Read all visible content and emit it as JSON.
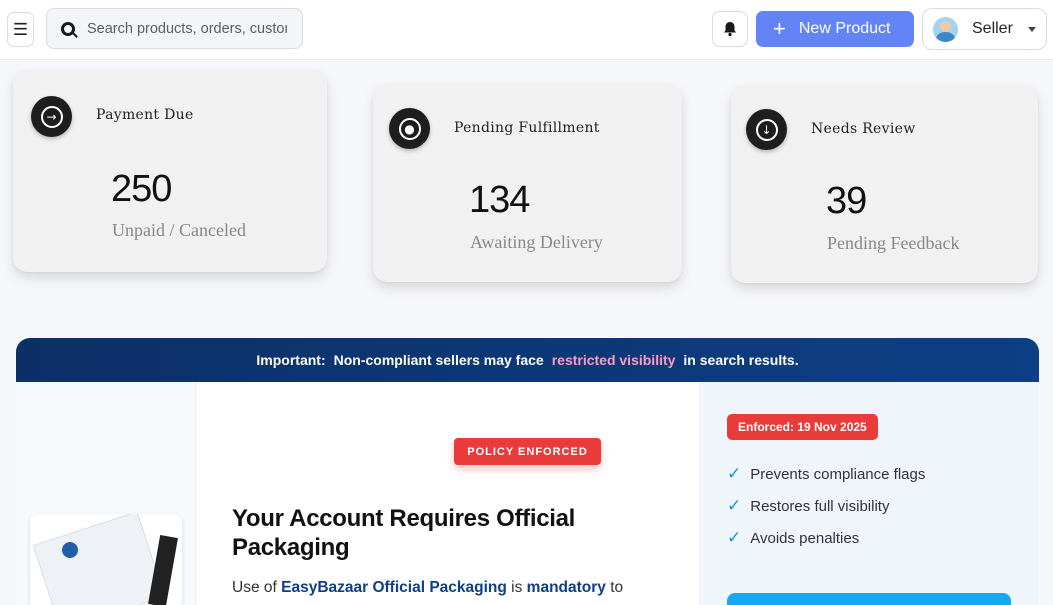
{
  "header": {
    "search_placeholder": "Search products, orders, customers",
    "new_product_label": "New Product",
    "user_label": "Seller"
  },
  "cards": [
    {
      "title": "Payment Due",
      "value": "250",
      "subtitle": "Unpaid / Canceled",
      "icon": "arrow-right-circle-icon"
    },
    {
      "title": "Pending Fulfillment",
      "value": "134",
      "subtitle": "Awaiting Delivery",
      "icon": "user-circle-icon"
    },
    {
      "title": "Needs Review",
      "value": "39",
      "subtitle": "Pending Feedback",
      "icon": "arrow-down-circle-icon"
    }
  ],
  "banner": {
    "label": "Important:",
    "text_before": "Non-compliant sellers may face",
    "highlight": "restricted visibility",
    "text_after": "in search results."
  },
  "notice": {
    "badge": "POLICY ENFORCED",
    "headline": "Your Account Requires Official Packaging",
    "body_prefix": "Use of",
    "body_brand": "EasyBazaar Official Packaging",
    "body_mid": "is",
    "body_emph": "mandatory",
    "body_suffix": "to"
  },
  "sidebar_panel": {
    "enforced_badge": "Enforced: 19 Nov 2025",
    "checks": [
      "Prevents compliance flags",
      "Restores full visibility",
      "Avoids penalties"
    ]
  },
  "colors": {
    "primary_button": "#6384f7",
    "banner_bg": "#0d3f86",
    "alert_red": "#ea3b3b",
    "highlight_pink": "#ff9bc0",
    "check_blue": "#1197d6"
  }
}
